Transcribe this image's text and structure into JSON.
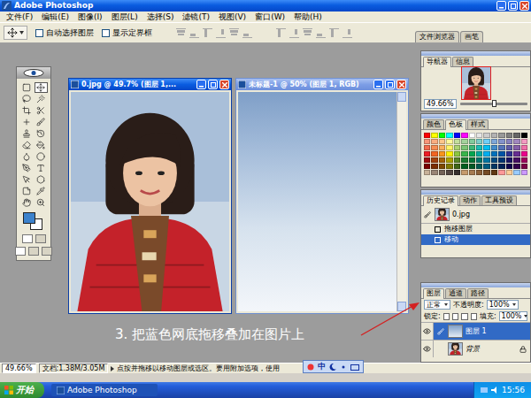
{
  "app": {
    "title": "Adobe Photoshop"
  },
  "menu": [
    "文件(F)",
    "编辑(E)",
    "图像(I)",
    "图层(L)",
    "选择(S)",
    "滤镜(T)",
    "视图(V)",
    "窗口(W)",
    "帮助(H)"
  ],
  "options": {
    "checkboxes": [
      {
        "label": "自动选择图层",
        "checked": false
      },
      {
        "label": "显示定界框",
        "checked": false
      }
    ],
    "align_disabled": true,
    "palette_well": [
      "文件浏览器",
      "画笔"
    ]
  },
  "toolbox": {
    "tools": [
      {
        "kind": "marquee",
        "selected": false
      },
      {
        "kind": "move",
        "selected": true
      },
      {
        "kind": "lasso",
        "selected": false
      },
      {
        "kind": "wand",
        "selected": false
      },
      {
        "kind": "crop",
        "selected": false
      },
      {
        "kind": "slice",
        "selected": false
      },
      {
        "kind": "heal",
        "selected": false
      },
      {
        "kind": "brush",
        "selected": false
      },
      {
        "kind": "stamp",
        "selected": false
      },
      {
        "kind": "history",
        "selected": false
      },
      {
        "kind": "eraser",
        "selected": false
      },
      {
        "kind": "bucket",
        "selected": false
      },
      {
        "kind": "blur",
        "selected": false
      },
      {
        "kind": "dodge",
        "selected": false
      },
      {
        "kind": "pen",
        "selected": false
      },
      {
        "kind": "type",
        "selected": false
      },
      {
        "kind": "select",
        "selected": false
      },
      {
        "kind": "shape",
        "selected": false
      },
      {
        "kind": "notes",
        "selected": false
      },
      {
        "kind": "eyedropper",
        "selected": false
      },
      {
        "kind": "hand",
        "selected": false
      },
      {
        "kind": "zoom",
        "selected": false
      }
    ]
  },
  "documents": [
    {
      "title": "0.jpg @ 49.7% (图层 1,...",
      "kind": "photo",
      "active": true,
      "scrollbar": false
    },
    {
      "title": "未标题-1 @ 50% (图层 1, RGB)",
      "kind": "gradient",
      "active": false,
      "scrollbar": true
    }
  ],
  "navigator": {
    "tabs": [
      {
        "label": "导航器",
        "selected": true
      },
      {
        "label": "信息",
        "selected": false
      }
    ],
    "zoom": "49.66%",
    "slider_level": 0.5
  },
  "swatches_palette": {
    "tabs": [
      {
        "label": "颜色",
        "selected": false
      },
      {
        "label": "色板",
        "selected": true
      },
      {
        "label": "样式",
        "selected": false
      }
    ],
    "swatches": [
      "#ff0000",
      "#ffff00",
      "#00ff00",
      "#00ffff",
      "#0000ff",
      "#ff00ff",
      "#ffffff",
      "#e6e6e6",
      "#cccccc",
      "#b3b3b3",
      "#999999",
      "#808080",
      "#666666",
      "#000000",
      "#f7977a",
      "#f9ad81",
      "#fdc68a",
      "#fff79a",
      "#c4df9b",
      "#a3d39c",
      "#82ca9d",
      "#7bcdc8",
      "#6ecff6",
      "#7ea7d8",
      "#8493ca",
      "#8882be",
      "#a187be",
      "#f49ac2",
      "#f26c4f",
      "#f68e55",
      "#fbaf5c",
      "#fff467",
      "#acd372",
      "#7cc576",
      "#3bb878",
      "#1abbb4",
      "#00bff3",
      "#438ccb",
      "#5574b9",
      "#605ca8",
      "#855fa8",
      "#f06ea9",
      "#ed1c24",
      "#f26522",
      "#f7941d",
      "#fff200",
      "#8dc73f",
      "#39b54a",
      "#00a651",
      "#00a99d",
      "#00aeef",
      "#0072bc",
      "#0054a5",
      "#2e3192",
      "#662d91",
      "#ec008c",
      "#9e0b0f",
      "#a0410d",
      "#a36209",
      "#aba000",
      "#598527",
      "#1a7b30",
      "#007236",
      "#00746b",
      "#0076a3",
      "#004b80",
      "#003471",
      "#1b1464",
      "#440e62",
      "#9e005d",
      "#790000",
      "#7b2e00",
      "#7d4900",
      "#827b00",
      "#406618",
      "#005e20",
      "#005826",
      "#005952",
      "#005b7f",
      "#003663",
      "#002157",
      "#0d004c",
      "#32004b",
      "#7b0046",
      "#c7b299",
      "#998675",
      "#736357",
      "#534741",
      "#37302d",
      "#c69c6d",
      "#a67c52",
      "#8c6239",
      "#754c24",
      "#603913",
      "#ff9999",
      "#ffcc99",
      "#99ccff",
      "#cc99ff"
    ]
  },
  "history": {
    "tabs": [
      {
        "label": "历史记录",
        "selected": true
      },
      {
        "label": "动作",
        "selected": false
      },
      {
        "label": "工具预设",
        "selected": false
      }
    ],
    "snapshot": "0.jpg",
    "steps": [
      {
        "label": "拖移图层",
        "selected": false
      },
      {
        "label": "移动",
        "selected": true
      }
    ]
  },
  "layers": {
    "tabs": [
      {
        "label": "图层",
        "selected": true
      },
      {
        "label": "通道",
        "selected": false
      },
      {
        "label": "路径",
        "selected": false
      }
    ],
    "blend_mode": "正常",
    "opacity_label": "不透明度:",
    "opacity": "100%",
    "lock_label": "锁定:",
    "fill_label": "填充:",
    "fill": "100%",
    "rows": [
      {
        "name": "图层 1",
        "selected": true,
        "visible": true,
        "kind": "gradient",
        "locked": false
      },
      {
        "name": "背景",
        "selected": false,
        "visible": true,
        "kind": "photo",
        "locked": true
      }
    ]
  },
  "caption": "3. 把蓝色网底拖移叠加在图片上",
  "status_bar": {
    "zoom": "49.66%",
    "document": "文档:1.38M/3.05M",
    "hint": "点按并拖移以移动图层或选区。要用附加选项，使用"
  },
  "ime": {
    "mode": "中"
  },
  "taskbar": {
    "start": "开始",
    "tasks": [
      {
        "label": "Adobe Photoshop",
        "selected": true
      }
    ],
    "clock": "15:56"
  }
}
